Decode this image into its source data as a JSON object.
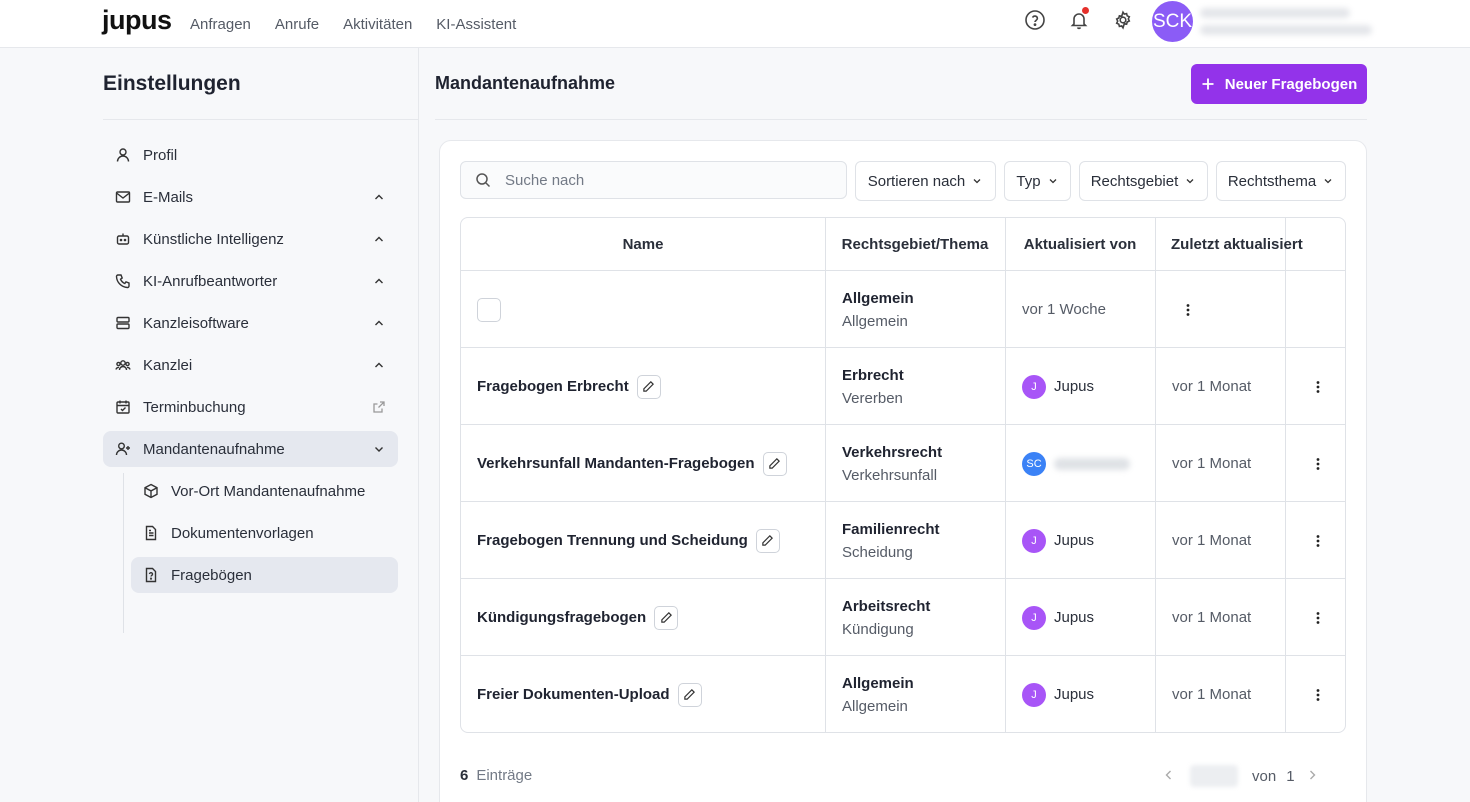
{
  "topnav": {
    "logo": "jupus",
    "links": [
      "Anfragen",
      "Anrufe",
      "Aktivitäten",
      "KI-Assistent"
    ],
    "avatar_initials": "SCK",
    "icons": [
      "help-icon",
      "bell-icon",
      "gear-icon"
    ]
  },
  "settings": {
    "title": "Einstellungen",
    "items": [
      {
        "label": "Profil",
        "icon": "user-icon"
      },
      {
        "label": "E-Mails",
        "icon": "mail-icon"
      },
      {
        "label": "Künstliche Intelligenz",
        "icon": "robot-icon"
      },
      {
        "label": "KI-Anrufbeantworter",
        "icon": "phone-icon"
      },
      {
        "label": "Kanzleisoftware",
        "icon": "server-icon"
      },
      {
        "label": "Kanzlei",
        "icon": "team-icon"
      },
      {
        "label": "Terminbuchung",
        "icon": "calendar-icon"
      },
      {
        "label": "Mandantenaufnahme",
        "icon": "user-plus-icon"
      }
    ],
    "subitems": [
      {
        "label": "Vor-Ort Mandantenaufnahme",
        "icon": "cube-icon"
      },
      {
        "label": "Dokumentenvorlagen",
        "icon": "document-icon"
      },
      {
        "label": "Fragebögen",
        "icon": "question-file-icon"
      }
    ]
  },
  "main": {
    "title": "Mandantenaufnahme",
    "new_button": "Neuer Fragebogen",
    "search_placeholder": "Suche nach",
    "filters": [
      "Sortieren nach",
      "Typ",
      "Rechtsgebiet",
      "Rechtsthema"
    ],
    "columns": [
      "Name",
      "Rechtsgebiet/Thema",
      "Aktualisiert von",
      "Zuletzt aktualisiert"
    ],
    "rows": [
      {
        "name": "",
        "area": "Allgemein",
        "topic": "Allgemein",
        "user": "",
        "initials": "",
        "updated": "vor 1 Woche"
      },
      {
        "name": "Fragebogen Erbrecht",
        "area": "Erbrecht",
        "topic": "Vererben",
        "user": "Jupus",
        "initials": "J",
        "updated": "vor 1 Monat"
      },
      {
        "name": "Verkehrsunfall Mandanten-Fragebogen",
        "area": "Verkehrsrecht",
        "topic": "Verkehrsunfall",
        "user": "",
        "initials": "SC",
        "updated": "vor 1 Monat"
      },
      {
        "name": "Fragebogen Trennung und Scheidung",
        "area": "Familienrecht",
        "topic": "Scheidung",
        "user": "Jupus",
        "initials": "J",
        "updated": "vor 1 Monat"
      },
      {
        "name": "Kündigungsfragebogen",
        "area": "Arbeitsrecht",
        "topic": "Kündigung",
        "user": "Jupus",
        "initials": "J",
        "updated": "vor 1 Monat"
      },
      {
        "name": "Freier Dokumenten-Upload",
        "area": "Allgemein",
        "topic": "Allgemein",
        "user": "Jupus",
        "initials": "J",
        "updated": "vor 1 Monat"
      }
    ],
    "footer": {
      "count": "6",
      "count_label": "Einträge",
      "of_label": "von",
      "total_pages": "1"
    }
  },
  "colors": {
    "accent": "#9333ea",
    "avatar_purple": "#8b5cf6",
    "avatar_blue": "#3b82f6"
  }
}
